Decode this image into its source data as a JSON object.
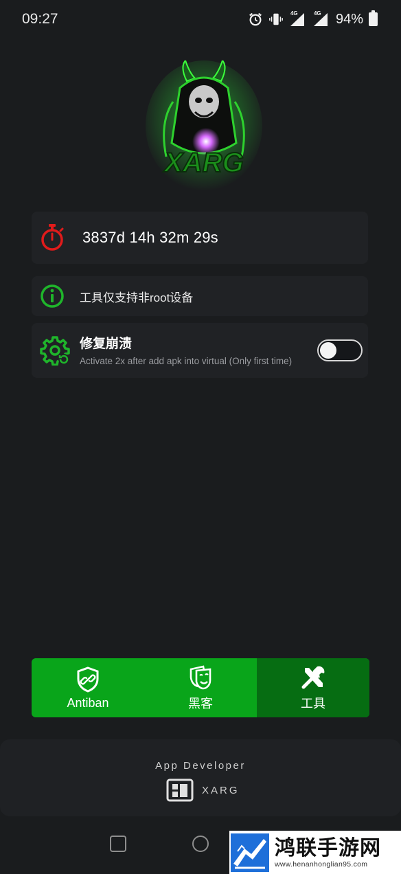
{
  "status_bar": {
    "time": "09:27",
    "network_tag_1": "4G",
    "network_tag_2": "4G",
    "battery": "94%",
    "icons": [
      "alarm-icon",
      "vibrate-icon",
      "signal-icon",
      "signal-icon",
      "battery-icon"
    ]
  },
  "logo": {
    "text": "XARG"
  },
  "timer_card": {
    "icon": "stopwatch-icon",
    "value": "3837d 14h 32m 29s"
  },
  "info_card": {
    "icon": "info-icon",
    "text": "工具仅支持非root设备"
  },
  "fix_card": {
    "icon": "gear-refresh-icon",
    "title": "修复崩溃",
    "subtitle": "Activate 2x after add apk into virtual (Only first time)",
    "toggle_on": false
  },
  "tabs": [
    {
      "label": "Antiban",
      "icon": "shield-link-icon",
      "active": false
    },
    {
      "label": "黑客",
      "icon": "mask-icon",
      "active": false
    },
    {
      "label": "工具",
      "icon": "tools-icon",
      "active": true
    }
  ],
  "developer": {
    "label": "App Developer",
    "name": "XARG",
    "icon": "developer-icon"
  },
  "watermark": {
    "text": "鸿联手游网",
    "url": "www.henanhonglian95.com"
  },
  "colors": {
    "background": "#1a1c1e",
    "card": "#202225",
    "accent_green": "#09a51a",
    "active_tab": "#066d12",
    "timer_red": "#e01b1b",
    "icon_green": "#1fb52b"
  }
}
